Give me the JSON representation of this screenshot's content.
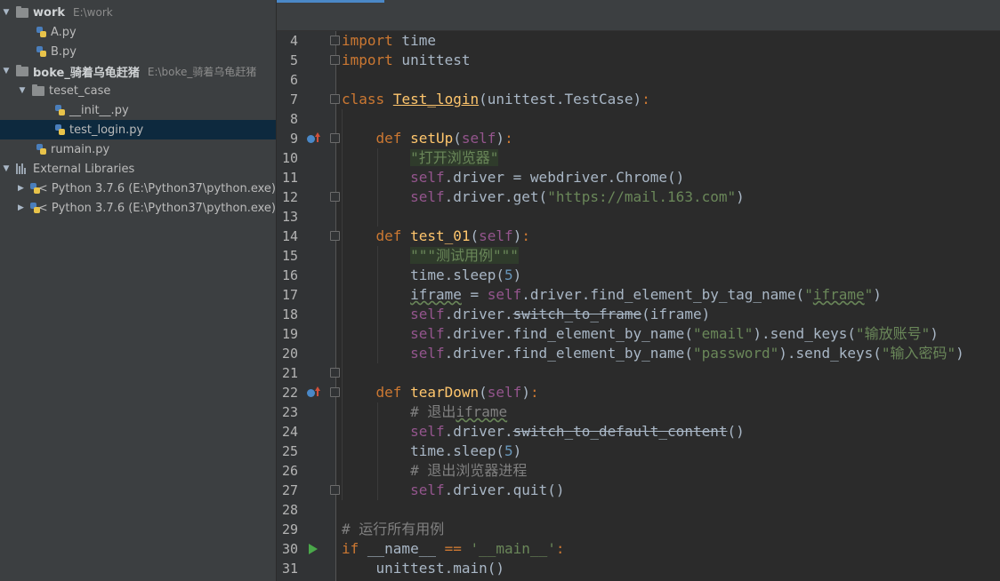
{
  "project_tree": {
    "items": [
      {
        "label": "work",
        "path": "E:\\work"
      },
      {
        "label": "A.py"
      },
      {
        "label": "B.py"
      },
      {
        "label": "boke_骑着乌龟赶猪",
        "path": "E:\\boke_骑着乌龟赶猪"
      },
      {
        "label": "teset_case"
      },
      {
        "label": "__init__.py"
      },
      {
        "label": "test_login.py"
      },
      {
        "label": "rumain.py"
      },
      {
        "label": "External Libraries"
      },
      {
        "label": "< Python 3.7.6 (E:\\Python37\\python.exe)"
      },
      {
        "label": "< Python 3.7.6 (E:\\Python37\\python.exe)"
      }
    ],
    "selected": "test_login.py"
  },
  "editor": {
    "line_numbers": [
      "4",
      "5",
      "6",
      "7",
      "8",
      "9",
      "10",
      "11",
      "12",
      "13",
      "14",
      "15",
      "16",
      "17",
      "18",
      "19",
      "20",
      "21",
      "22",
      "23",
      "24",
      "25",
      "26",
      "27",
      "28",
      "29",
      "30",
      "31"
    ],
    "code": {
      "t_import": "import",
      "t_time": " time",
      "t_unittest": " unittest",
      "t_class": "class",
      "t_classname": "Test_login",
      "t_testcase": "unittest.TestCase",
      "t_def": "def",
      "t_setup": "setUp",
      "t_self": "self",
      "t_doc1": "\"打开浏览器\"",
      "t_driver_eq": ".driver = webdriver.Chrome()",
      "t_driver_get": ".driver.get(",
      "t_url": "\"https://mail.163.com\"",
      "t_test01": "test_01",
      "t_doc2": "\"\"\"测试用例\"\"\"",
      "t_sleep": "time.sleep(",
      "t_5": "5",
      "t_iframe_var": "iframe",
      "t_find_tag": ".driver.find_element_by_tag_name(",
      "t_iframe_str_q": "\"",
      "t_iframe_str": "iframe",
      "t_driver": ".driver.",
      "t_switch_frame": "switch_to_frame",
      "t_iframe_arg": "(iframe)",
      "t_find_name": ".driver.find_element_by_name(",
      "t_email": "\"email\"",
      "t_send_keys": ").send_keys(",
      "t_input_account": "\"输放账号\"",
      "t_password": "\"password\"",
      "t_input_pwd": "\"输入密码\"",
      "t_teardown": "tearDown",
      "t_cm_exit_iframe_a": "# 退出",
      "t_cm_exit_iframe_b": "iframe",
      "t_switch_default": "switch_to_default_content",
      "t_cm_exit_browser": "# 退出浏览器进程",
      "t_quit": ".driver.quit()",
      "t_cm_run_all": "# 运行所有用例",
      "t_if": "if",
      "t_name": " __name__ ",
      "t_eqeq": "==",
      "t_main_str": "'__main__'",
      "t_unittest_main": "unittest.main()"
    }
  }
}
